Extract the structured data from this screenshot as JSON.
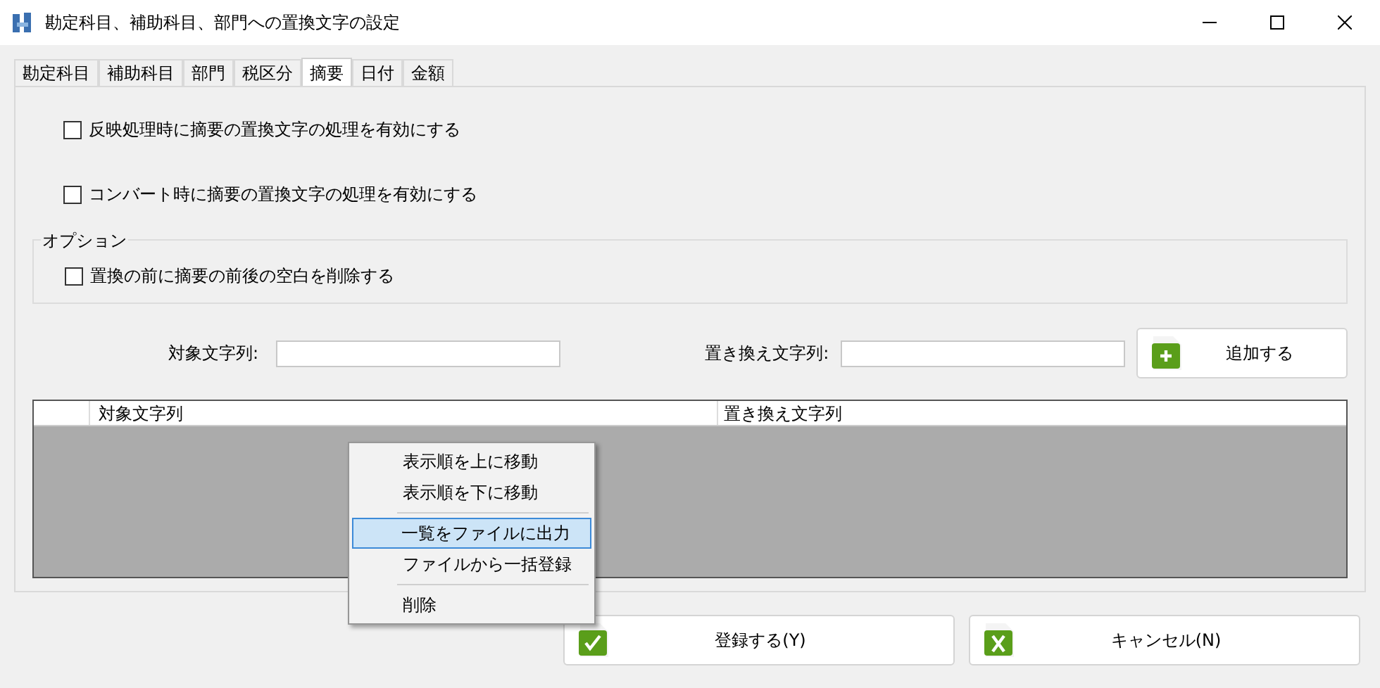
{
  "window": {
    "title": "勘定科目、補助科目、部門への置換文字の設定"
  },
  "tabs": [
    {
      "label": "勘定科目",
      "selected": false
    },
    {
      "label": "補助科目",
      "selected": false
    },
    {
      "label": "部門",
      "selected": false
    },
    {
      "label": "税区分",
      "selected": false
    },
    {
      "label": "摘要",
      "selected": true
    },
    {
      "label": "日付",
      "selected": false
    },
    {
      "label": "金額",
      "selected": false
    }
  ],
  "options": [
    {
      "label": "反映処理時に摘要の置換文字の処理を有効にする",
      "checked": false
    },
    {
      "label": "コンバート時に摘要の置換文字の処理を有効にする",
      "checked": false
    }
  ],
  "option_group": {
    "title": "オプション",
    "items": [
      {
        "label": "置換の前に摘要の前後の空白を削除する",
        "checked": false
      }
    ]
  },
  "form": {
    "target_label": "対象文字列:",
    "replace_label": "置き換え文字列:",
    "add_button": "追加する"
  },
  "table": {
    "columns": [
      "対象文字列",
      "置き換え文字列"
    ]
  },
  "context_menu": [
    {
      "kind": "item",
      "label": "表示順を上に移動",
      "selected": false
    },
    {
      "kind": "item",
      "label": "表示順を下に移動",
      "selected": false
    },
    {
      "kind": "separator"
    },
    {
      "kind": "item",
      "label": "一覧をファイルに出力",
      "selected": true
    },
    {
      "kind": "item",
      "label": "ファイルから一括登録",
      "selected": false
    },
    {
      "kind": "separator"
    },
    {
      "kind": "item",
      "label": "削除",
      "selected": false
    }
  ],
  "buttons": [
    {
      "label": "登録する(Y)",
      "kind": "ok"
    },
    {
      "label": "キャンセル(N)",
      "kind": "cancel"
    }
  ]
}
